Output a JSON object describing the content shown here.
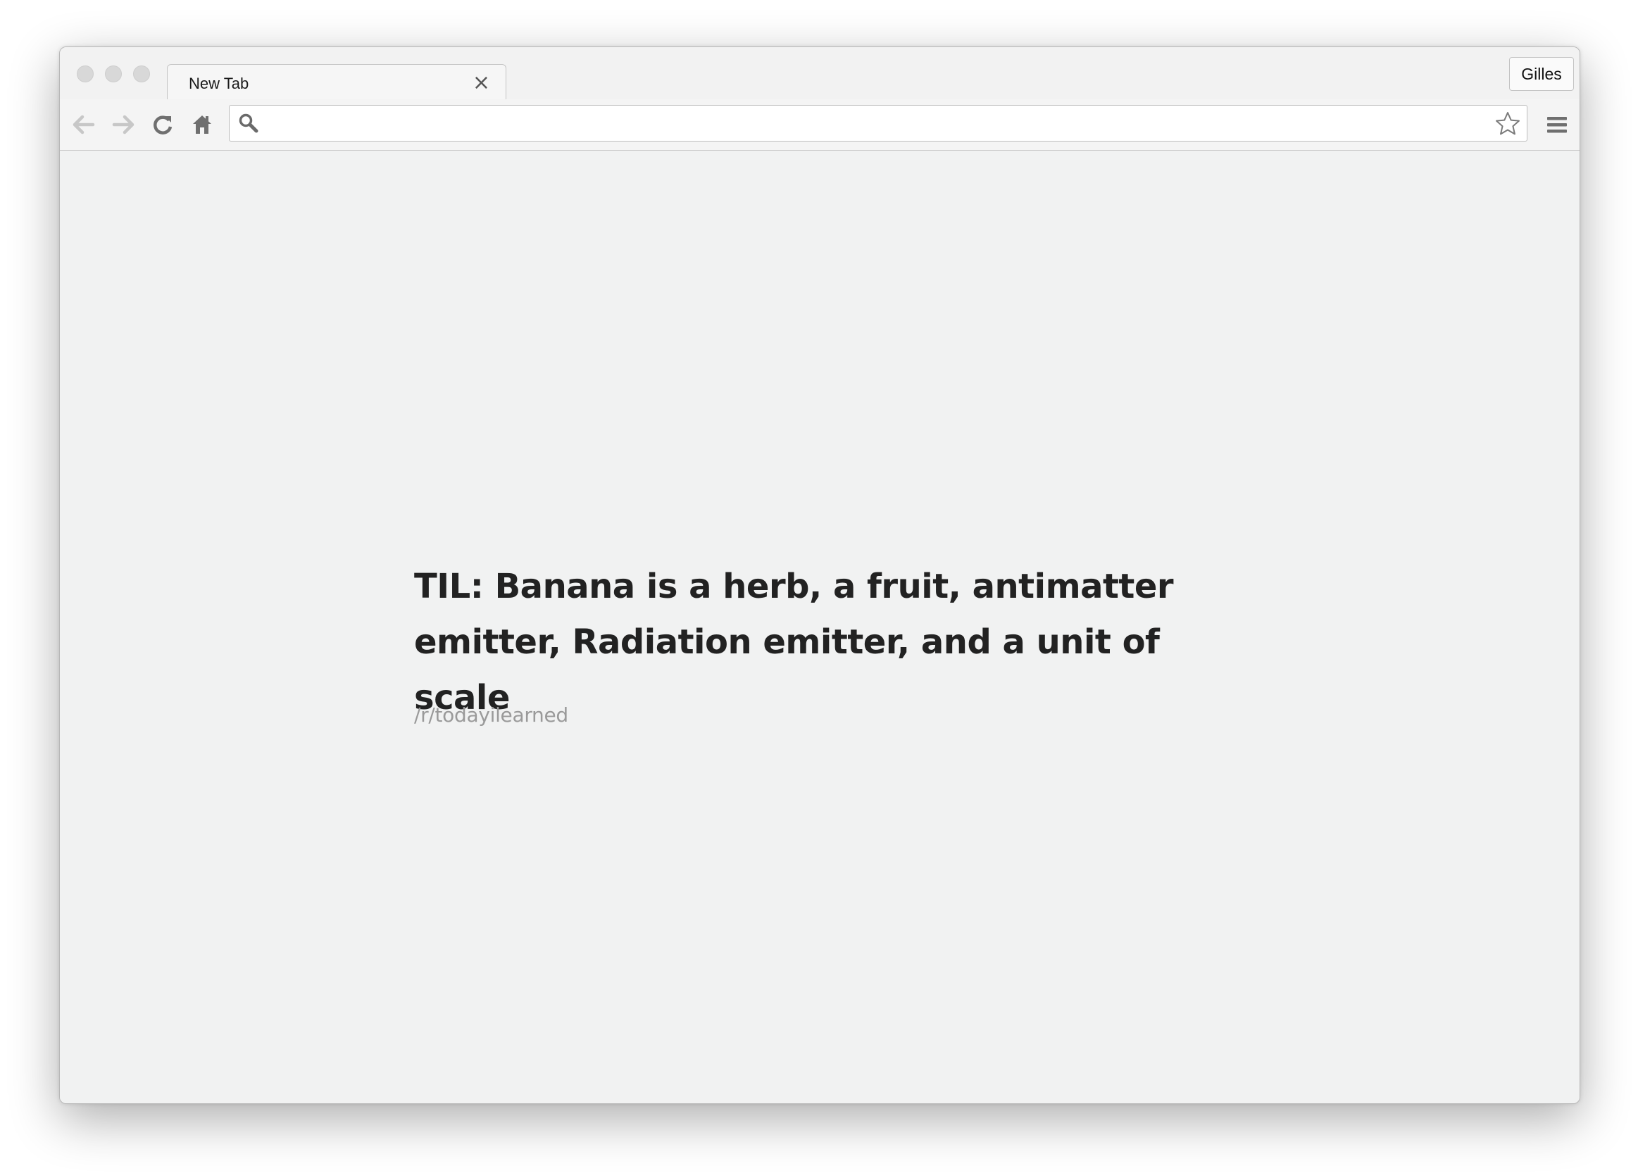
{
  "browser": {
    "tab": {
      "title": "New Tab",
      "close_glyph": "×"
    },
    "profile_button": "Gilles",
    "omnibox": {
      "value": "",
      "placeholder": ""
    },
    "icons": {
      "back": "back-arrow-icon",
      "forward": "forward-arrow-icon",
      "reload": "reload-icon",
      "home": "home-icon",
      "search": "search-icon",
      "bookmark": "star-icon",
      "menu": "hamburger-menu-icon"
    }
  },
  "content": {
    "headline": "TIL: Banana is a herb, a fruit, antimatter emitter, Radiation emitter, and a unit of scale",
    "subreddit": "/r/todayilearned"
  },
  "colors": {
    "page_background": "#f1f2f2",
    "headline_text": "#222222",
    "subreddit_text": "#9a9a9a"
  }
}
